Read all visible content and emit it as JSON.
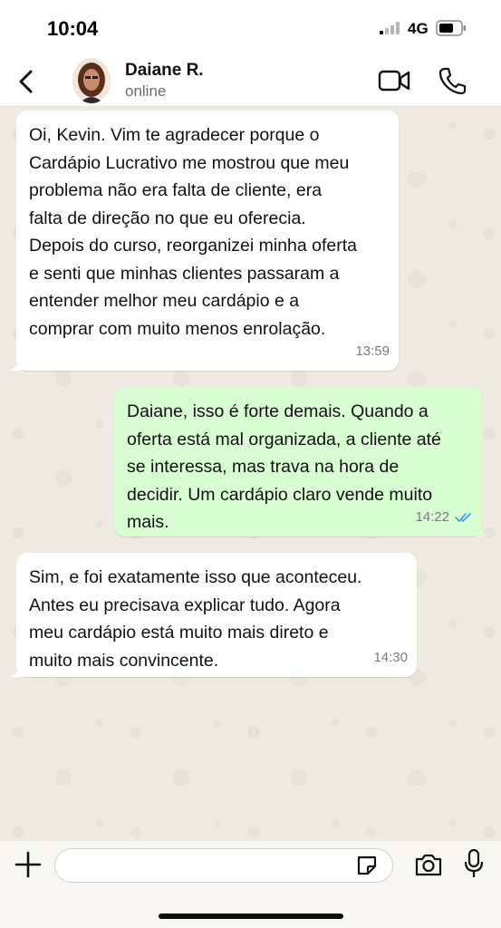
{
  "status_bar": {
    "time": "10:04",
    "network": "4G",
    "icons": [
      "signal-icon",
      "battery-icon"
    ]
  },
  "header": {
    "contact_name": "Daiane R.",
    "contact_status": "online",
    "icons": [
      "back-chevron-icon",
      "video-call-icon",
      "phone-icon"
    ]
  },
  "messages": [
    {
      "direction": "incoming",
      "text": "Oi, Kevin. Vim te agradecer porque o\nCardápio Lucrativo me mostrou que meu\nproblema não era falta de cliente, era\nfalta de direção no que eu oferecia.\nDepois do curso, reorganizei minha oferta\ne senti que minhas clientes passaram a\nentender melhor meu cardápio e a\ncomprar com muito menos enrolação.",
      "time": "13:59"
    },
    {
      "direction": "outgoing",
      "text": "Daiane, isso é forte demais. Quando a\noferta está mal organizada, a cliente até\nse interessa, mas trava na hora de\ndecidir. Um cardápio claro vende muito\nmais.",
      "time": "14:22",
      "status": "read"
    },
    {
      "direction": "incoming",
      "text": "Sim, e foi exatamente isso que aconteceu.\nAntes eu precisava explicar tudo. Agora\nmeu cardápio está muito mais direto e\nmuito mais convincente.",
      "time": "14:30"
    }
  ],
  "composer": {
    "placeholder": "",
    "icons": [
      "plus-icon",
      "sticker-icon",
      "camera-icon",
      "microphone-icon"
    ]
  },
  "colors": {
    "outgoing_bubble": "#d9fdd3",
    "incoming_bubble": "#ffffff",
    "chat_background": "#efeae1",
    "read_ticks": "#3497f9"
  }
}
